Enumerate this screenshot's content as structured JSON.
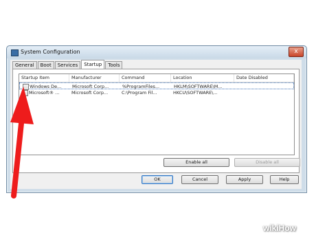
{
  "window": {
    "title": "System Configuration",
    "close_glyph": "x"
  },
  "tabs": [
    {
      "label": "General"
    },
    {
      "label": "Boot"
    },
    {
      "label": "Services"
    },
    {
      "label": "Startup",
      "active": true
    },
    {
      "label": "Tools"
    }
  ],
  "table": {
    "columns": [
      "Startup Item",
      "Manufacturer",
      "Command",
      "Location",
      "Date Disabled"
    ],
    "rows": [
      {
        "checked": false,
        "selected": true,
        "cells": [
          "Windows De...",
          "Microsoft Corp...",
          "%ProgramFiles...",
          "HKLM\\SOFTWARE\\M...",
          ""
        ]
      },
      {
        "checked": false,
        "selected": false,
        "cells": [
          "Microsoft® ...",
          "Microsoft Corp...",
          "C:\\Program Fil...",
          "HKCU\\SOFTWARE\\...",
          ""
        ]
      }
    ]
  },
  "buttons": {
    "enable_all": "Enable all",
    "disable_all": "Disable all",
    "ok": "OK",
    "cancel": "Cancel",
    "apply": "Apply",
    "help": "Help"
  },
  "annotation": {
    "arrow_color": "#ee1c1c"
  },
  "watermark": {
    "text": "wikiHow"
  }
}
